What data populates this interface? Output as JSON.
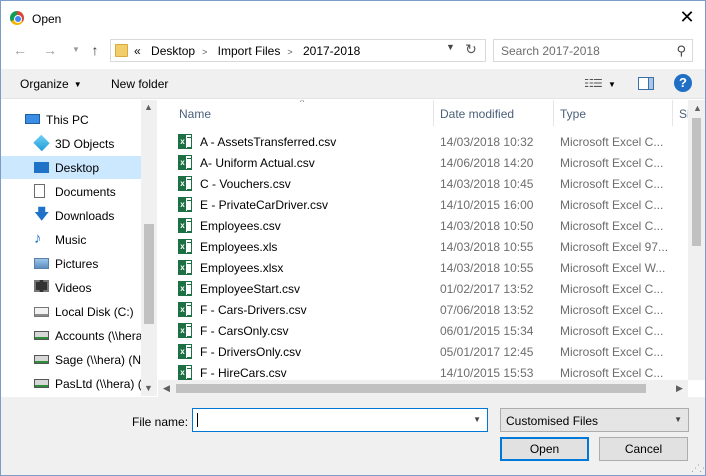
{
  "titlebar": {
    "title": "Open",
    "close": "✕"
  },
  "address": {
    "overflow": "«",
    "crumbs": [
      "Desktop",
      "Import Files",
      "2017-2018"
    ],
    "search_placeholder": "Search 2017-2018"
  },
  "toolbar": {
    "organize": "Organize",
    "new_folder": "New folder",
    "help": "?"
  },
  "nav": {
    "items": [
      {
        "label": "This PC",
        "icon": "pc-icon"
      },
      {
        "label": "3D Objects",
        "icon": "cube-icon"
      },
      {
        "label": "Desktop",
        "icon": "desktop-icon",
        "selected": true
      },
      {
        "label": "Documents",
        "icon": "documents-icon"
      },
      {
        "label": "Downloads",
        "icon": "download-icon"
      },
      {
        "label": "Music",
        "icon": "music-icon"
      },
      {
        "label": "Pictures",
        "icon": "pictures-icon"
      },
      {
        "label": "Videos",
        "icon": "videos-icon"
      },
      {
        "label": "Local Disk (C:)",
        "icon": "drive-icon"
      },
      {
        "label": "Accounts (\\\\hera",
        "icon": "network-drive-icon"
      },
      {
        "label": "Sage (\\\\hera) (N",
        "icon": "network-drive-icon"
      },
      {
        "label": "PasLtd (\\\\hera) (",
        "icon": "network-drive-icon"
      }
    ]
  },
  "columns": {
    "name": "Name",
    "date": "Date modified",
    "type": "Type",
    "size": "Si"
  },
  "files": [
    {
      "name": "A - AssetsTransferred.csv",
      "date": "14/03/2018 10:32",
      "type": "Microsoft Excel C..."
    },
    {
      "name": "A- Uniform Actual.csv",
      "date": "14/06/2018 14:20",
      "type": "Microsoft Excel C..."
    },
    {
      "name": "C - Vouchers.csv",
      "date": "14/03/2018 10:45",
      "type": "Microsoft Excel C..."
    },
    {
      "name": "E - PrivateCarDriver.csv",
      "date": "14/10/2015 16:00",
      "type": "Microsoft Excel C..."
    },
    {
      "name": "Employees.csv",
      "date": "14/03/2018 10:50",
      "type": "Microsoft Excel C..."
    },
    {
      "name": "Employees.xls",
      "date": "14/03/2018 10:55",
      "type": "Microsoft Excel 97..."
    },
    {
      "name": "Employees.xlsx",
      "date": "14/03/2018 10:55",
      "type": "Microsoft Excel W..."
    },
    {
      "name": "EmployeeStart.csv",
      "date": "01/02/2017 13:52",
      "type": "Microsoft Excel C..."
    },
    {
      "name": "F - Cars-Drivers.csv",
      "date": "07/06/2018 13:52",
      "type": "Microsoft Excel C..."
    },
    {
      "name": "F - CarsOnly.csv",
      "date": "06/01/2015 15:34",
      "type": "Microsoft Excel C..."
    },
    {
      "name": "F - DriversOnly.csv",
      "date": "05/01/2017 12:45",
      "type": "Microsoft Excel C..."
    },
    {
      "name": "F - HireCars.csv",
      "date": "14/10/2015 15:53",
      "type": "Microsoft Excel C..."
    }
  ],
  "bottom": {
    "file_name_label": "File name:",
    "file_name_value": "",
    "file_type": "Customised Files",
    "open": "Open",
    "cancel": "Cancel"
  },
  "colors": {
    "selection": "#cce8ff",
    "accent": "#0078d7",
    "excel_green": "#1d7044"
  }
}
